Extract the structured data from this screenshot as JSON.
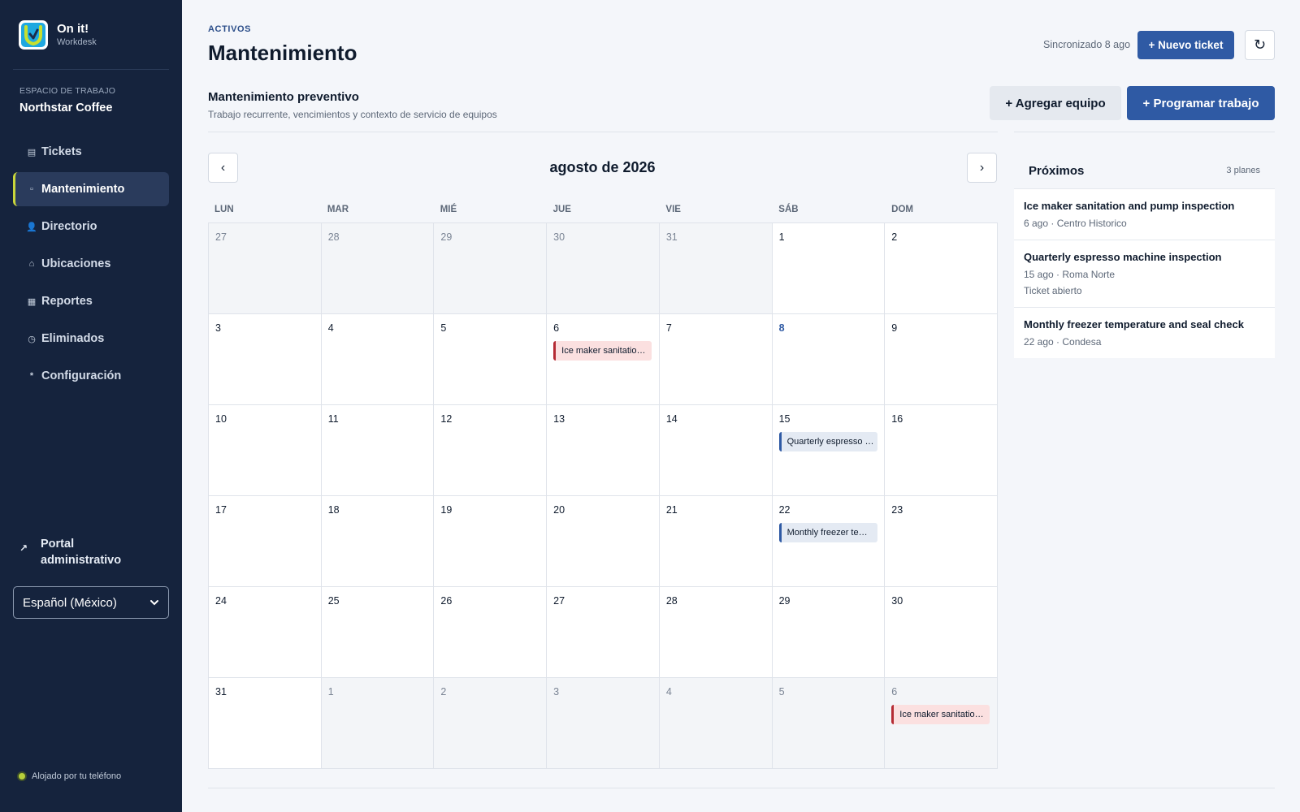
{
  "brand": {
    "name": "On it!",
    "sub": "Workdesk"
  },
  "workspace": {
    "label": "ESPACIO DE TRABAJO",
    "name": "Northstar Coffee"
  },
  "nav": [
    {
      "label": "Tickets",
      "icon": "▤",
      "icon_name": "tickets-icon"
    },
    {
      "label": "Mantenimiento",
      "icon": "▫",
      "icon_name": "maintenance-icon",
      "active": true
    },
    {
      "label": "Directorio",
      "icon": "👤",
      "icon_name": "person-icon"
    },
    {
      "label": "Ubicaciones",
      "icon": "⌂",
      "icon_name": "home-icon"
    },
    {
      "label": "Reportes",
      "icon": "▦",
      "icon_name": "reports-icon"
    },
    {
      "label": "Eliminados",
      "icon": "◷",
      "icon_name": "clock-icon"
    },
    {
      "label": "Configuración",
      "icon": "*",
      "icon_name": "settings-icon"
    }
  ],
  "portal": {
    "label": "Portal administrativo",
    "icon": "↗"
  },
  "language": {
    "selected": "Español (México)"
  },
  "hosted": "Alojado por tu teléfono",
  "header": {
    "crumb": "ACTIVOS",
    "title": "Mantenimiento",
    "sync": "Sincronizado 8 ago",
    "new_ticket": "+ Nuevo ticket",
    "refresh_icon": "↻"
  },
  "section": {
    "title": "Mantenimiento preventivo",
    "subtitle": "Trabajo recurrente, vencimientos y contexto de servicio de equipos",
    "add_equipment": "+  Agregar equipo",
    "schedule_work": "+  Programar trabajo"
  },
  "calendar": {
    "month": "agosto de 2026",
    "prev": "‹",
    "next": "›",
    "days_of_week": [
      "LUN",
      "MAR",
      "MIÉ",
      "JUE",
      "VIE",
      "SÁB",
      "DOM"
    ],
    "cells": [
      {
        "d": "27",
        "other": true
      },
      {
        "d": "28",
        "other": true
      },
      {
        "d": "29",
        "other": true
      },
      {
        "d": "30",
        "other": true
      },
      {
        "d": "31",
        "other": true
      },
      {
        "d": "1"
      },
      {
        "d": "2"
      },
      {
        "d": "3"
      },
      {
        "d": "4"
      },
      {
        "d": "5"
      },
      {
        "d": "6",
        "event": {
          "label": "Ice maker sanitation and pump inspection",
          "color": "red"
        }
      },
      {
        "d": "7"
      },
      {
        "d": "8",
        "today": true
      },
      {
        "d": "9"
      },
      {
        "d": "10"
      },
      {
        "d": "11"
      },
      {
        "d": "12"
      },
      {
        "d": "13"
      },
      {
        "d": "14"
      },
      {
        "d": "15",
        "event": {
          "label": "Quarterly espresso machine inspection",
          "color": "blue"
        }
      },
      {
        "d": "16"
      },
      {
        "d": "17"
      },
      {
        "d": "18"
      },
      {
        "d": "19"
      },
      {
        "d": "20"
      },
      {
        "d": "21"
      },
      {
        "d": "22",
        "event": {
          "label": "Monthly freezer temperature and seal check",
          "color": "blue"
        }
      },
      {
        "d": "23"
      },
      {
        "d": "24"
      },
      {
        "d": "25"
      },
      {
        "d": "26"
      },
      {
        "d": "27"
      },
      {
        "d": "28"
      },
      {
        "d": "29"
      },
      {
        "d": "30"
      },
      {
        "d": "31"
      },
      {
        "d": "1",
        "other": true
      },
      {
        "d": "2",
        "other": true
      },
      {
        "d": "3",
        "other": true
      },
      {
        "d": "4",
        "other": true
      },
      {
        "d": "5",
        "other": true
      },
      {
        "d": "6",
        "other": true,
        "event": {
          "label": "Ice maker sanitation and pump inspection",
          "color": "red"
        }
      }
    ]
  },
  "upcoming": {
    "title": "Próximos",
    "count": "3 planes",
    "items": [
      {
        "title": "Ice maker sanitation and pump inspection",
        "meta": "6 ago · Centro Historico"
      },
      {
        "title": "Quarterly espresso machine inspection",
        "meta": "15 ago · Roma Norte",
        "status": "Ticket abierto"
      },
      {
        "title": "Monthly freezer temperature and seal check",
        "meta": "22 ago · Condesa"
      }
    ]
  },
  "colors": {
    "sidebar": "#15233d",
    "accent": "#2f5aa4",
    "active_marker": "#c9d63b",
    "event_red": "#b52b34"
  }
}
